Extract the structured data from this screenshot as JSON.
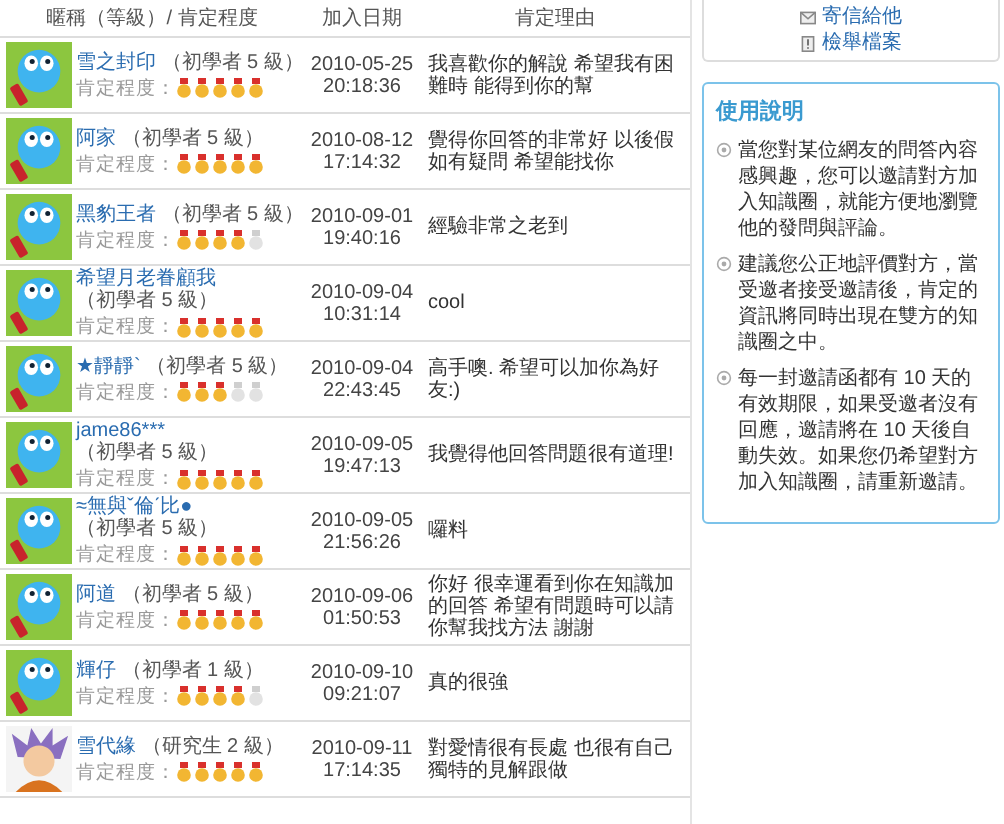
{
  "table": {
    "columns": [
      "暱稱（等級）/ 肯定程度",
      "加入日期",
      "肯定理由"
    ],
    "rows": [
      {
        "avatar": {
          "kind": "balloon"
        },
        "name": "雪之封印",
        "level": "（初學者 5 級）",
        "rating_label": "肯定程度：",
        "stars": 5,
        "date": "2010-05-25",
        "time": "20:18:36",
        "reason": "我喜歡你的解說 希望我有困難時 能得到你的幫"
      },
      {
        "avatar": {
          "kind": "balloon"
        },
        "name": "阿家",
        "level": "（初學者 5 級）",
        "rating_label": "肯定程度：",
        "stars": 5,
        "date": "2010-08-12",
        "time": "17:14:32",
        "reason": "覺得你回答的非常好 以後假如有疑問 希望能找你"
      },
      {
        "avatar": {
          "kind": "balloon"
        },
        "name": "黑豹王者",
        "level": "（初學者 5 級）",
        "rating_label": "肯定程度：",
        "stars": 4,
        "date": "2010-09-01",
        "time": "19:40:16",
        "reason": "經驗非常之老到"
      },
      {
        "avatar": {
          "kind": "balloon"
        },
        "name": "希望月老眷顧我",
        "level": "（初學者 5 級）",
        "rating_label": "肯定程度：",
        "stars": 5,
        "date": "2010-09-04",
        "time": "10:31:14",
        "reason": "cool"
      },
      {
        "avatar": {
          "kind": "balloon"
        },
        "name": "★靜靜`",
        "level": "（初學者 5 級）",
        "rating_label": "肯定程度：",
        "stars": 3,
        "date": "2010-09-04",
        "time": "22:43:45",
        "reason": "高手噢. 希望可以加你為好友:)"
      },
      {
        "avatar": {
          "kind": "balloon"
        },
        "name": "jame86***",
        "level": "（初學者 5 級）",
        "rating_label": "肯定程度：",
        "stars": 5,
        "date": "2010-09-05",
        "time": "19:47:13",
        "reason": "我覺得他回答問題很有道理!"
      },
      {
        "avatar": {
          "kind": "balloon"
        },
        "name": "≈無與ˇ倫ˊ比●",
        "level": "（初學者 5 級）",
        "rating_label": "肯定程度：",
        "stars": 5,
        "date": "2010-09-05",
        "time": "21:56:26",
        "reason": "囉料"
      },
      {
        "avatar": {
          "kind": "balloon"
        },
        "name": "阿道",
        "level": "（初學者 5 級）",
        "rating_label": "肯定程度：",
        "stars": 5,
        "date": "2010-09-06",
        "time": "01:50:53",
        "reason": "你好 很幸運看到你在知識加的回答 希望有問題時可以請你幫我找方法 謝謝"
      },
      {
        "avatar": {
          "kind": "balloon"
        },
        "name": "輝仔",
        "level": "（初學者 1 級）",
        "rating_label": "肯定程度：",
        "stars": 4,
        "date": "2010-09-10",
        "time": "09:21:07",
        "reason": "真的很強"
      },
      {
        "avatar": {
          "kind": "figure"
        },
        "name": "雪代緣",
        "level": "（研究生 2 級）",
        "rating_label": "肯定程度：",
        "stars": 5,
        "date": "2010-09-11",
        "time": "17:14:35",
        "reason": "對愛情很有長處 也很有自己獨特的見解跟做"
      }
    ]
  },
  "sidebar": {
    "links": [
      {
        "kind": "mail",
        "label": "寄信給他"
      },
      {
        "kind": "report",
        "label": "檢舉檔案"
      }
    ],
    "help": {
      "title": "使用說明",
      "items": [
        "當您對某位網友的問答內容感興趣，您可以邀請對方加入知識圈，就能方便地瀏覽他的發問與評論。",
        "建議您公正地評價對方，當受邀者接受邀請後，肯定的資訊將同時出現在雙方的知識圈之中。",
        "每一封邀請函都有 10 天的有效期限，如果受邀者沒有回應，邀請將在 10 天後自動失效。如果您仍希望對方加入知識圈，請重新邀請。"
      ]
    }
  }
}
